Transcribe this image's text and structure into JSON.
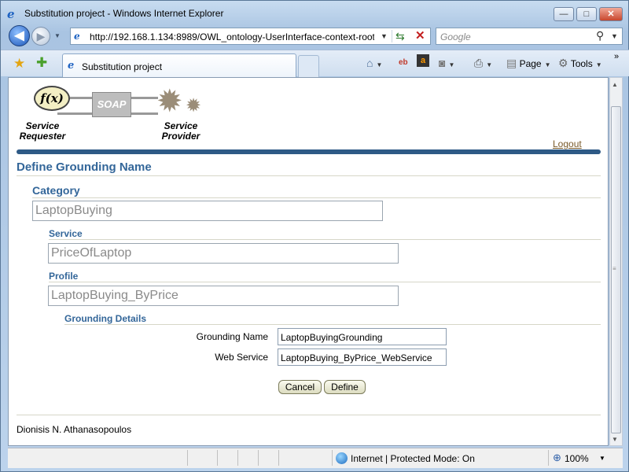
{
  "window": {
    "title": "Substitution project - Windows Internet Explorer",
    "minimize": "—",
    "maximize": "□",
    "close": "✕"
  },
  "navbar": {
    "back_glyph": "◀",
    "forward_glyph": "▶",
    "address": "http://192.168.1.134:8989/OWL_ontology-UserInterface-context-root/",
    "search_placeholder": "Google"
  },
  "tabs": [
    {
      "label": "Substitution project"
    }
  ],
  "commands": {
    "page": "Page",
    "tools": "Tools"
  },
  "banner": {
    "fx": "f(x)",
    "soap": "SOAP",
    "requester_line1": "Service",
    "requester_line2": "Requester",
    "provider_line1": "Service",
    "provider_line2": "Provider",
    "logout": "Logout"
  },
  "page": {
    "title": "Define Grounding Name",
    "category_heading": "Category",
    "category_value": "LaptopBuying",
    "service_heading": "Service",
    "service_value": "PriceOfLaptop",
    "profile_heading": "Profile",
    "profile_value": "LaptopBuying_ByPrice",
    "details_heading": "Grounding Details",
    "grounding_name_label": "Grounding Name",
    "grounding_name_value": "LaptopBuyingGrounding",
    "web_service_label": "Web Service",
    "web_service_value": "LaptopBuying_ByPrice_WebService",
    "cancel": "Cancel",
    "define": "Define",
    "footer": "Dionisis N. Athanasopoulos"
  },
  "statusbar": {
    "zone": "Internet | Protected Mode: On",
    "zoom": "100%"
  },
  "icons": {
    "favorites": "favorites-star-icon",
    "add_favorites": "add-favorites-icon",
    "home": "home-icon",
    "ebay": "ebay-icon",
    "amazon": "amazon-icon",
    "feeds": "rss-icon",
    "print": "print-icon",
    "page": "page-icon",
    "tools": "gear-icon"
  }
}
